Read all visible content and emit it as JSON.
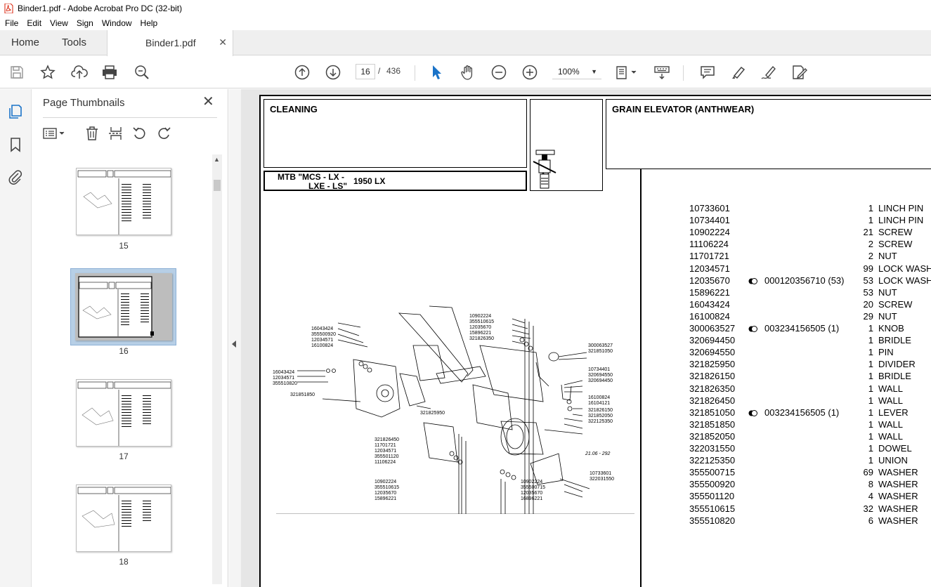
{
  "window": {
    "title": "Binder1.pdf - Adobe Acrobat Pro DC (32-bit)"
  },
  "menu": [
    "File",
    "Edit",
    "View",
    "Sign",
    "Window",
    "Help"
  ],
  "tabs": {
    "home": "Home",
    "tools": "Tools",
    "document": "Binder1.pdf"
  },
  "toolbar": {
    "current_page": "16",
    "page_separator": "/",
    "total_pages": "436",
    "zoom": "100%"
  },
  "sidebar": {
    "title": "Page Thumbnails",
    "thumbnails": [
      {
        "label": "15"
      },
      {
        "label": "16",
        "selected": true
      },
      {
        "label": "17"
      },
      {
        "label": "18"
      }
    ]
  },
  "document": {
    "section_left": "CLEANING",
    "section_right": "GRAIN ELEVATOR (ANTHWEAR)",
    "model_line1": "MTB \"MCS - LX -",
    "model_line2": "LXE - LS\"",
    "model_number": "1950 LX",
    "diagram_date": "21.06 - 292",
    "diagram_labels": {
      "top_center": [
        "10902224",
        "355510615",
        "12035670",
        "15896221",
        "321826350"
      ],
      "top_left": [
        "16043424",
        "355500920",
        "12034571",
        "16100824"
      ],
      "left": [
        "16043424",
        "12034571",
        "355510820"
      ],
      "left_mid": "321851850",
      "center": "321825950",
      "right_top": [
        "300063527",
        "321851050"
      ],
      "right_mid": [
        "10734401",
        "320694550",
        "320694450"
      ],
      "right_low": [
        "16100824",
        "16104121",
        "321826150",
        "321852050",
        "322125350"
      ],
      "bottom_left": [
        "321826450",
        "11701721",
        "12034571",
        "355501120",
        "11106224"
      ],
      "bottom_left2": [
        "10902224",
        "355510615",
        "12035670",
        "15896221"
      ],
      "bottom_center": [
        "10902224",
        "355500715",
        "12035670",
        "16896221"
      ],
      "bottom_right": [
        "10733601",
        "322031550"
      ]
    },
    "parts": [
      {
        "pn": "10733601",
        "sym": "",
        "ref": "",
        "qty": "1",
        "desc": "LINCH PIN"
      },
      {
        "pn": "10734401",
        "sym": "",
        "ref": "",
        "qty": "1",
        "desc": "LINCH PIN"
      },
      {
        "pn": "10902224",
        "sym": "",
        "ref": "",
        "qty": "21",
        "desc": "SCREW"
      },
      {
        "pn": "11106224",
        "sym": "",
        "ref": "",
        "qty": "2",
        "desc": "SCREW"
      },
      {
        "pn": "11701721",
        "sym": "",
        "ref": "",
        "qty": "2",
        "desc": "NUT"
      },
      {
        "pn": "12034571",
        "sym": "",
        "ref": "",
        "qty": "99",
        "desc": "LOCK WASHE"
      },
      {
        "pn": "12035670",
        "sym": "half-circle-icon",
        "ref": "000120356710  (53)",
        "qty": "53",
        "desc": "LOCK WASHE"
      },
      {
        "pn": "15896221",
        "sym": "",
        "ref": "",
        "qty": "53",
        "desc": "NUT"
      },
      {
        "pn": "16043424",
        "sym": "",
        "ref": "",
        "qty": "20",
        "desc": "SCREW"
      },
      {
        "pn": "16100824",
        "sym": "",
        "ref": "",
        "qty": "29",
        "desc": "NUT"
      },
      {
        "pn": "300063527",
        "sym": "half-circle-icon",
        "ref": "003234156505  (1)",
        "qty": "1",
        "desc": "KNOB"
      },
      {
        "pn": "320694450",
        "sym": "",
        "ref": "",
        "qty": "1",
        "desc": "BRIDLE"
      },
      {
        "pn": "320694550",
        "sym": "",
        "ref": "",
        "qty": "1",
        "desc": "PIN"
      },
      {
        "pn": "321825950",
        "sym": "",
        "ref": "",
        "qty": "1",
        "desc": "DIVIDER"
      },
      {
        "pn": "321826150",
        "sym": "",
        "ref": "",
        "qty": "1",
        "desc": "BRIDLE"
      },
      {
        "pn": "321826350",
        "sym": "",
        "ref": "",
        "qty": "1",
        "desc": "WALL"
      },
      {
        "pn": "321826450",
        "sym": "",
        "ref": "",
        "qty": "1",
        "desc": "WALL"
      },
      {
        "pn": "321851050",
        "sym": "half-circle-icon",
        "ref": "003234156505  (1)",
        "qty": "1",
        "desc": "LEVER"
      },
      {
        "pn": "321851850",
        "sym": "",
        "ref": "",
        "qty": "1",
        "desc": "WALL"
      },
      {
        "pn": "321852050",
        "sym": "",
        "ref": "",
        "qty": "1",
        "desc": "WALL"
      },
      {
        "pn": "322031550",
        "sym": "",
        "ref": "",
        "qty": "1",
        "desc": "DOWEL"
      },
      {
        "pn": "322125350",
        "sym": "",
        "ref": "",
        "qty": "1",
        "desc": "UNION"
      },
      {
        "pn": "355500715",
        "sym": "",
        "ref": "",
        "qty": "69",
        "desc": "WASHER"
      },
      {
        "pn": "355500920",
        "sym": "",
        "ref": "",
        "qty": "8",
        "desc": "WASHER"
      },
      {
        "pn": "355501120",
        "sym": "",
        "ref": "",
        "qty": "4",
        "desc": "WASHER"
      },
      {
        "pn": "355510615",
        "sym": "",
        "ref": "",
        "qty": "32",
        "desc": "WASHER"
      },
      {
        "pn": "355510820",
        "sym": "",
        "ref": "",
        "qty": "6",
        "desc": "WASHER"
      }
    ]
  },
  "colors": {
    "accent": "#1a73c8",
    "pdf_red": "#d81e05",
    "panel_bg": "#f4f4f4",
    "selection": "#b7cfe6"
  }
}
